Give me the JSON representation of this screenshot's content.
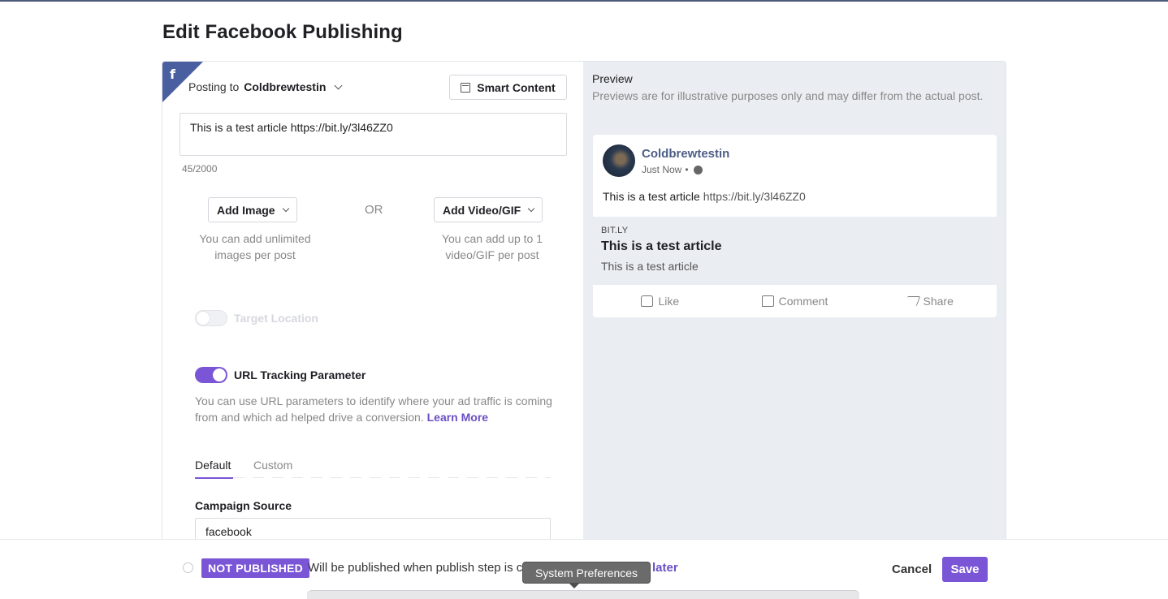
{
  "page": {
    "title": "Edit Facebook Publishing"
  },
  "editor": {
    "posting_to_label": "Posting to",
    "account": "Coldbrewtestin",
    "smart_content_label": "Smart Content",
    "post_text": "This is a test article https://bit.ly/3l46ZZ0",
    "char_count": "45/2000",
    "add_image_label": "Add Image",
    "or_label": "OR",
    "add_video_label": "Add Video/GIF",
    "image_help": "You can add unlimited images per post",
    "video_help": "You can add up to 1 video/GIF per post",
    "target_location": {
      "label": "Target Location",
      "enabled": false
    },
    "url_tracking": {
      "label": "URL Tracking Parameter",
      "enabled": true,
      "help": "You can use URL parameters to identify where your ad traffic is coming from and which ad helped drive a conversion.",
      "learn_more": "Learn More"
    },
    "tabs": [
      {
        "label": "Default",
        "active": true
      },
      {
        "label": "Custom",
        "active": false
      }
    ],
    "campaign_source": {
      "label": "Campaign Source",
      "value": "facebook"
    }
  },
  "preview": {
    "title": "Preview",
    "note": "Previews are for illustrative purposes only and may differ from the actual post.",
    "account_name": "Coldbrewtestin",
    "time": "Just Now",
    "separator": "•",
    "body_text": "This is a test article",
    "body_link": "https://bit.ly/3l46ZZ0",
    "link_domain": "BIT.LY",
    "link_title": "This is a test article",
    "link_desc": "This is a test article",
    "actions": [
      {
        "label": "Like",
        "icon": "thumbs-up-icon"
      },
      {
        "label": "Comment",
        "icon": "comment-icon"
      },
      {
        "label": "Share",
        "icon": "share-icon"
      }
    ]
  },
  "footer": {
    "status_badge": "NOT PUBLISHED",
    "status_text": "Will be published when publish step is co",
    "later_link": "r later",
    "cancel_label": "Cancel",
    "save_label": "Save"
  },
  "tooltip": {
    "text": "System Preferences"
  },
  "colors": {
    "accent": "#7a55d6",
    "facebook": "#4a5fa0",
    "preview_bg": "#eaedf2"
  }
}
